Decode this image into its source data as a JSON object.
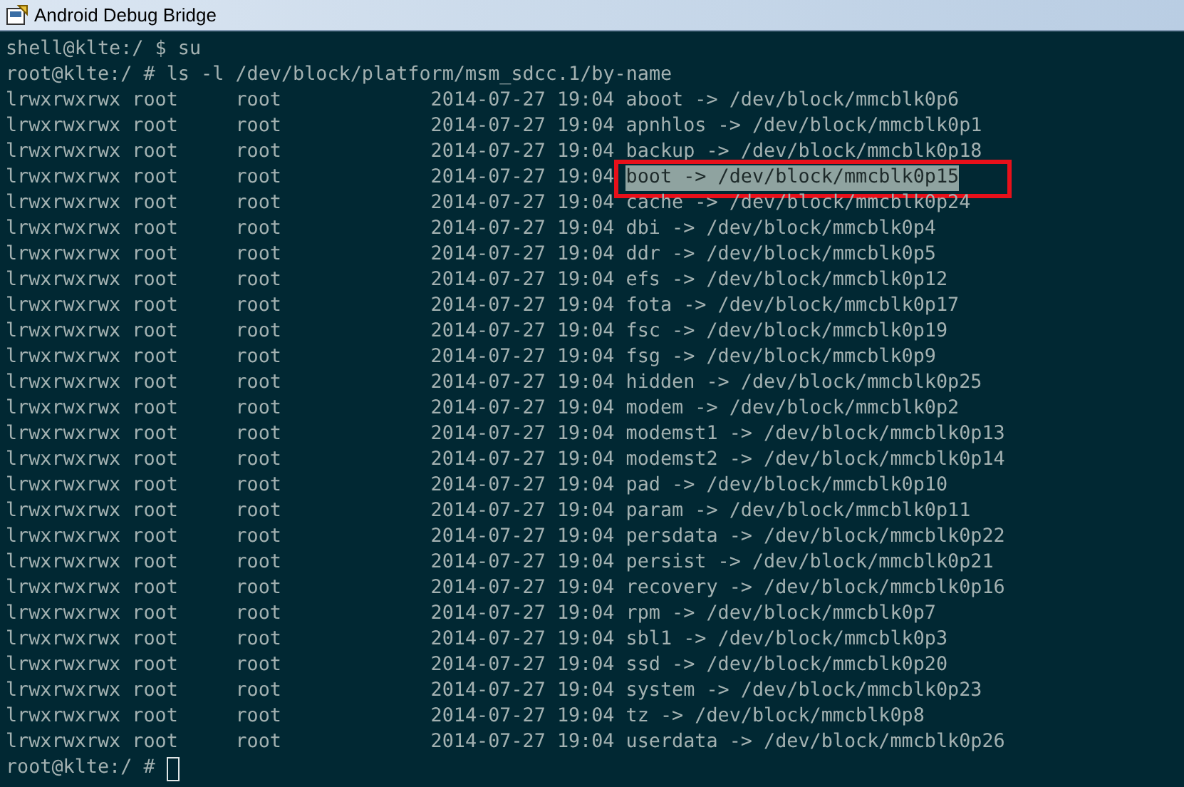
{
  "window": {
    "title": "Android Debug Bridge"
  },
  "prompt_lines": [
    "shell@klte:/ $ su",
    "root@klte:/ # ls -l /dev/block/platform/msm_sdcc.1/by-name"
  ],
  "entries": [
    {
      "perms": "lrwxrwxrwx",
      "owner": "root",
      "group": "root",
      "date": "2014-07-27",
      "time": "19:04",
      "link": "aboot -> /dev/block/mmcblk0p6",
      "selected": false,
      "boxed": false
    },
    {
      "perms": "lrwxrwxrwx",
      "owner": "root",
      "group": "root",
      "date": "2014-07-27",
      "time": "19:04",
      "link": "apnhlos -> /dev/block/mmcblk0p1",
      "selected": false,
      "boxed": false
    },
    {
      "perms": "lrwxrwxrwx",
      "owner": "root",
      "group": "root",
      "date": "2014-07-27",
      "time": "19:04",
      "link": "backup -> /dev/block/mmcblk0p18",
      "selected": false,
      "boxed": false
    },
    {
      "perms": "lrwxrwxrwx",
      "owner": "root",
      "group": "root",
      "date": "2014-07-27",
      "time": "19:04",
      "link": "boot -> /dev/block/mmcblk0p15",
      "selected": true,
      "boxed": true
    },
    {
      "perms": "lrwxrwxrwx",
      "owner": "root",
      "group": "root",
      "date": "2014-07-27",
      "time": "19:04",
      "link": "cache -> /dev/block/mmcblk0p24",
      "selected": false,
      "boxed": false
    },
    {
      "perms": "lrwxrwxrwx",
      "owner": "root",
      "group": "root",
      "date": "2014-07-27",
      "time": "19:04",
      "link": "dbi -> /dev/block/mmcblk0p4",
      "selected": false,
      "boxed": false
    },
    {
      "perms": "lrwxrwxrwx",
      "owner": "root",
      "group": "root",
      "date": "2014-07-27",
      "time": "19:04",
      "link": "ddr -> /dev/block/mmcblk0p5",
      "selected": false,
      "boxed": false
    },
    {
      "perms": "lrwxrwxrwx",
      "owner": "root",
      "group": "root",
      "date": "2014-07-27",
      "time": "19:04",
      "link": "efs -> /dev/block/mmcblk0p12",
      "selected": false,
      "boxed": false
    },
    {
      "perms": "lrwxrwxrwx",
      "owner": "root",
      "group": "root",
      "date": "2014-07-27",
      "time": "19:04",
      "link": "fota -> /dev/block/mmcblk0p17",
      "selected": false,
      "boxed": false
    },
    {
      "perms": "lrwxrwxrwx",
      "owner": "root",
      "group": "root",
      "date": "2014-07-27",
      "time": "19:04",
      "link": "fsc -> /dev/block/mmcblk0p19",
      "selected": false,
      "boxed": false
    },
    {
      "perms": "lrwxrwxrwx",
      "owner": "root",
      "group": "root",
      "date": "2014-07-27",
      "time": "19:04",
      "link": "fsg -> /dev/block/mmcblk0p9",
      "selected": false,
      "boxed": false
    },
    {
      "perms": "lrwxrwxrwx",
      "owner": "root",
      "group": "root",
      "date": "2014-07-27",
      "time": "19:04",
      "link": "hidden -> /dev/block/mmcblk0p25",
      "selected": false,
      "boxed": false
    },
    {
      "perms": "lrwxrwxrwx",
      "owner": "root",
      "group": "root",
      "date": "2014-07-27",
      "time": "19:04",
      "link": "modem -> /dev/block/mmcblk0p2",
      "selected": false,
      "boxed": false
    },
    {
      "perms": "lrwxrwxrwx",
      "owner": "root",
      "group": "root",
      "date": "2014-07-27",
      "time": "19:04",
      "link": "modemst1 -> /dev/block/mmcblk0p13",
      "selected": false,
      "boxed": false
    },
    {
      "perms": "lrwxrwxrwx",
      "owner": "root",
      "group": "root",
      "date": "2014-07-27",
      "time": "19:04",
      "link": "modemst2 -> /dev/block/mmcblk0p14",
      "selected": false,
      "boxed": false
    },
    {
      "perms": "lrwxrwxrwx",
      "owner": "root",
      "group": "root",
      "date": "2014-07-27",
      "time": "19:04",
      "link": "pad -> /dev/block/mmcblk0p10",
      "selected": false,
      "boxed": false
    },
    {
      "perms": "lrwxrwxrwx",
      "owner": "root",
      "group": "root",
      "date": "2014-07-27",
      "time": "19:04",
      "link": "param -> /dev/block/mmcblk0p11",
      "selected": false,
      "boxed": false
    },
    {
      "perms": "lrwxrwxrwx",
      "owner": "root",
      "group": "root",
      "date": "2014-07-27",
      "time": "19:04",
      "link": "persdata -> /dev/block/mmcblk0p22",
      "selected": false,
      "boxed": false
    },
    {
      "perms": "lrwxrwxrwx",
      "owner": "root",
      "group": "root",
      "date": "2014-07-27",
      "time": "19:04",
      "link": "persist -> /dev/block/mmcblk0p21",
      "selected": false,
      "boxed": false
    },
    {
      "perms": "lrwxrwxrwx",
      "owner": "root",
      "group": "root",
      "date": "2014-07-27",
      "time": "19:04",
      "link": "recovery -> /dev/block/mmcblk0p16",
      "selected": false,
      "boxed": false
    },
    {
      "perms": "lrwxrwxrwx",
      "owner": "root",
      "group": "root",
      "date": "2014-07-27",
      "time": "19:04",
      "link": "rpm -> /dev/block/mmcblk0p7",
      "selected": false,
      "boxed": false
    },
    {
      "perms": "lrwxrwxrwx",
      "owner": "root",
      "group": "root",
      "date": "2014-07-27",
      "time": "19:04",
      "link": "sbl1 -> /dev/block/mmcblk0p3",
      "selected": false,
      "boxed": false
    },
    {
      "perms": "lrwxrwxrwx",
      "owner": "root",
      "group": "root",
      "date": "2014-07-27",
      "time": "19:04",
      "link": "ssd -> /dev/block/mmcblk0p20",
      "selected": false,
      "boxed": false
    },
    {
      "perms": "lrwxrwxrwx",
      "owner": "root",
      "group": "root",
      "date": "2014-07-27",
      "time": "19:04",
      "link": "system -> /dev/block/mmcblk0p23",
      "selected": false,
      "boxed": false
    },
    {
      "perms": "lrwxrwxrwx",
      "owner": "root",
      "group": "root",
      "date": "2014-07-27",
      "time": "19:04",
      "link": "tz -> /dev/block/mmcblk0p8",
      "selected": false,
      "boxed": false
    },
    {
      "perms": "lrwxrwxrwx",
      "owner": "root",
      "group": "root",
      "date": "2014-07-27",
      "time": "19:04",
      "link": "userdata -> /dev/block/mmcblk0p26",
      "selected": false,
      "boxed": false
    }
  ],
  "final_prompt": "root@klte:/ #"
}
